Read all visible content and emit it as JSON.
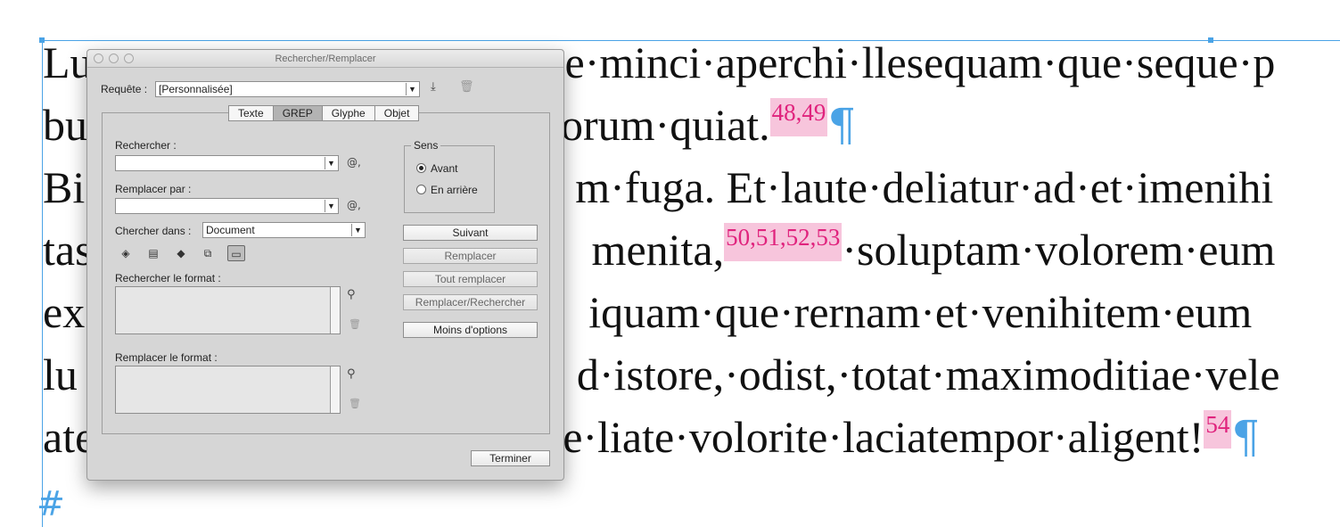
{
  "document": {
    "lines": [
      {
        "before": "Lu",
        "after": "e·minci·aperchi·llesequam·que·seque·p"
      },
      {
        "before": "bu",
        "after": "orum·quiat.",
        "note": "48,49",
        "pilcrow": "¶"
      },
      {
        "before": "Bi",
        "after": "m·fuga. Et·laute·deliatur·ad·et·imenihi"
      },
      {
        "before": "tas",
        "after": "menita,",
        "note": "50,51,52,53",
        "after2": "·soluptam·volorem·eum"
      },
      {
        "before": "ex",
        "after": "iquam·que·rernam·et·venihitem·eum"
      },
      {
        "before": "lu",
        "after": "d·istore,·odist,·totat·maximoditiae·vele"
      },
      {
        "before": "ate",
        "after": "e·liate·volorite·laciatempor·aligent!",
        "note": "54",
        "pilcrow": "¶"
      }
    ],
    "end_mark": "#"
  },
  "dialog": {
    "title": "Rechercher/Remplacer",
    "query_label": "Requête :",
    "query_value": "[Personnalisée]",
    "tabs": [
      "Texte",
      "GREP",
      "Glyphe",
      "Objet"
    ],
    "active_tab": "GREP",
    "find_label": "Rechercher :",
    "find_value": "",
    "replace_label": "Remplacer par :",
    "replace_value": "",
    "search_in_label": "Chercher dans :",
    "search_in_value": "Document",
    "find_format_label": "Rechercher le format :",
    "replace_format_label": "Remplacer le format :",
    "direction": {
      "legend": "Sens",
      "options": [
        "Avant",
        "En arrière"
      ],
      "selected": "Avant"
    },
    "buttons": {
      "next": "Suivant",
      "replace": "Remplacer",
      "replace_all": "Tout remplacer",
      "replace_find": "Remplacer/Rechercher",
      "fewer_options": "Moins d'options",
      "done": "Terminer"
    },
    "icons": {
      "save_query": "save-icon",
      "delete_query": "trash-icon",
      "special_chars": "at-symbol-icon"
    }
  },
  "colors": {
    "accent": "#4aa3e6",
    "note_bg": "#f7c5dc",
    "note_text": "#e0237d"
  }
}
